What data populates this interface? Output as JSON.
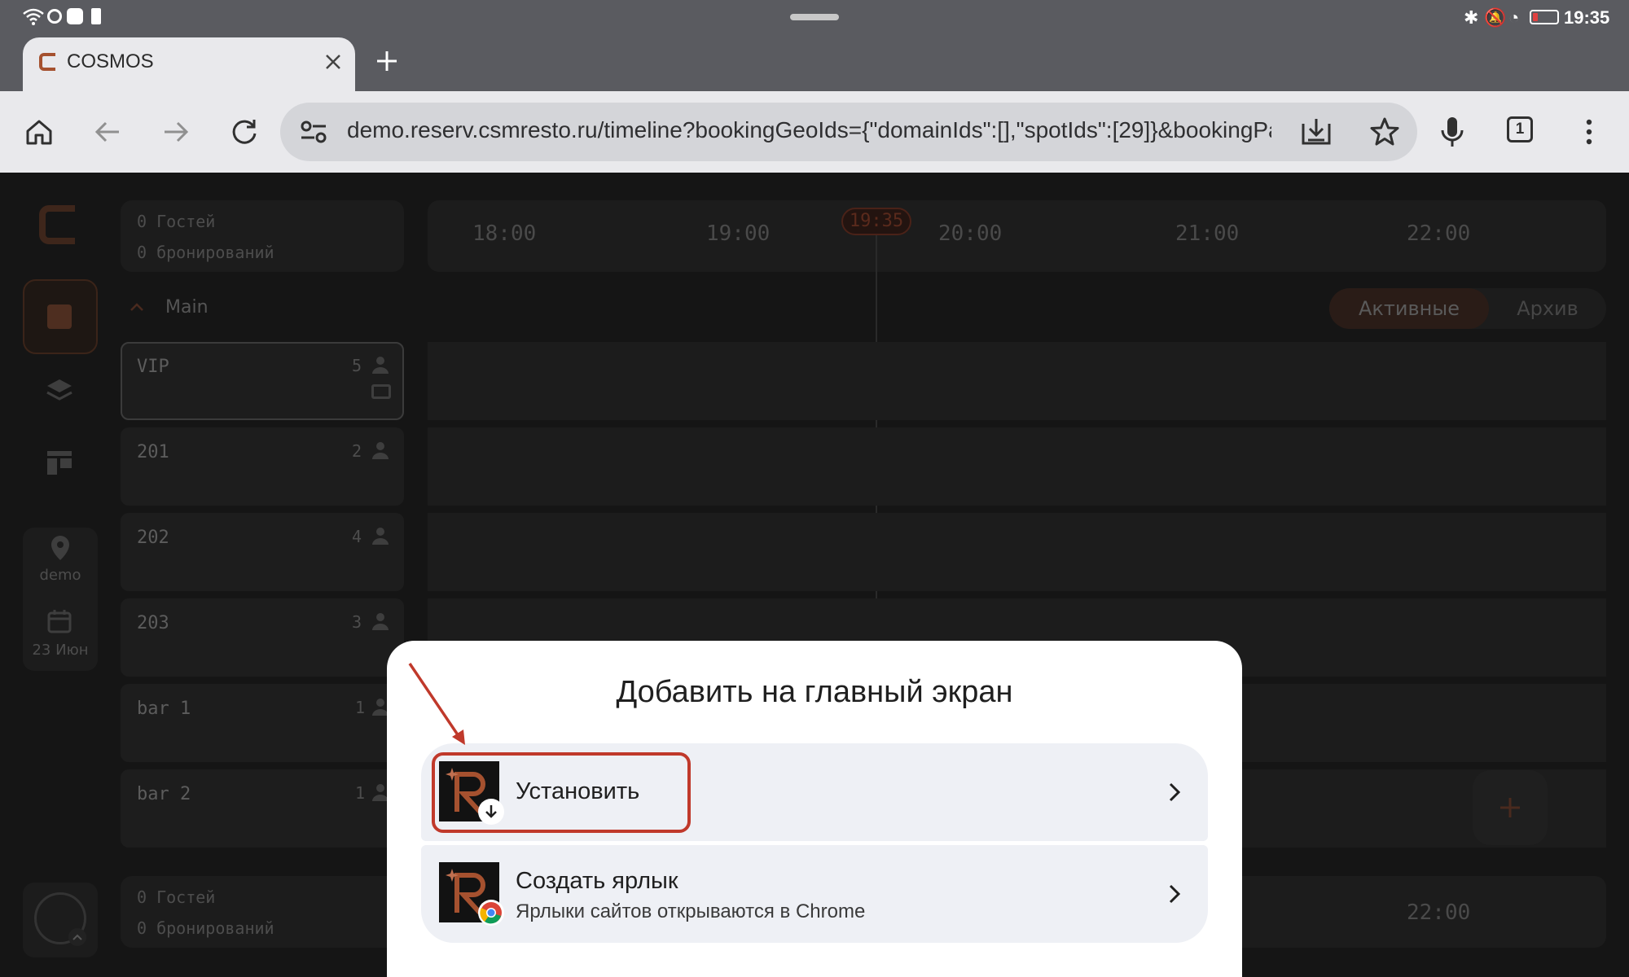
{
  "status_bar": {
    "time": "19:35"
  },
  "browser": {
    "tab_title": "COSMOS",
    "url": "demo.reserv.csmresto.ru/timeline?bookingGeoIds={\"domainIds\":[],\"spotIds\":[29]}&bookingPa",
    "tabs_count": "1"
  },
  "app": {
    "summary_top": {
      "guests": "0 Гостей",
      "bookings": "0 бронирований"
    },
    "summary_bottom": {
      "guests": "0 Гостей",
      "bookings": "0 бронирований"
    },
    "current_time": "19:35",
    "hours": [
      "18:00",
      "19:00",
      "20:00",
      "21:00",
      "22:00"
    ],
    "bottom_hour": "22:00",
    "section": "Main",
    "filters": {
      "active": "Активные",
      "archive": "Архив"
    },
    "location": "demo",
    "date": "23 Июн",
    "tables": [
      {
        "name": "VIP",
        "seats": "5"
      },
      {
        "name": "201",
        "seats": "2"
      },
      {
        "name": "202",
        "seats": "4"
      },
      {
        "name": "203",
        "seats": "3"
      },
      {
        "name": "bar 1",
        "seats": "1"
      },
      {
        "name": "bar 2",
        "seats": "1"
      }
    ]
  },
  "dialog": {
    "title": "Добавить на главный экран",
    "install_label": "Установить",
    "shortcut_label": "Создать ярлык",
    "shortcut_sub": "Ярлыки сайтов открываются в Chrome"
  },
  "colors": {
    "accent": "#c0392b",
    "brand": "#a5512f",
    "dialog_bg": "#ffffff",
    "option_bg": "#eef0f5"
  }
}
